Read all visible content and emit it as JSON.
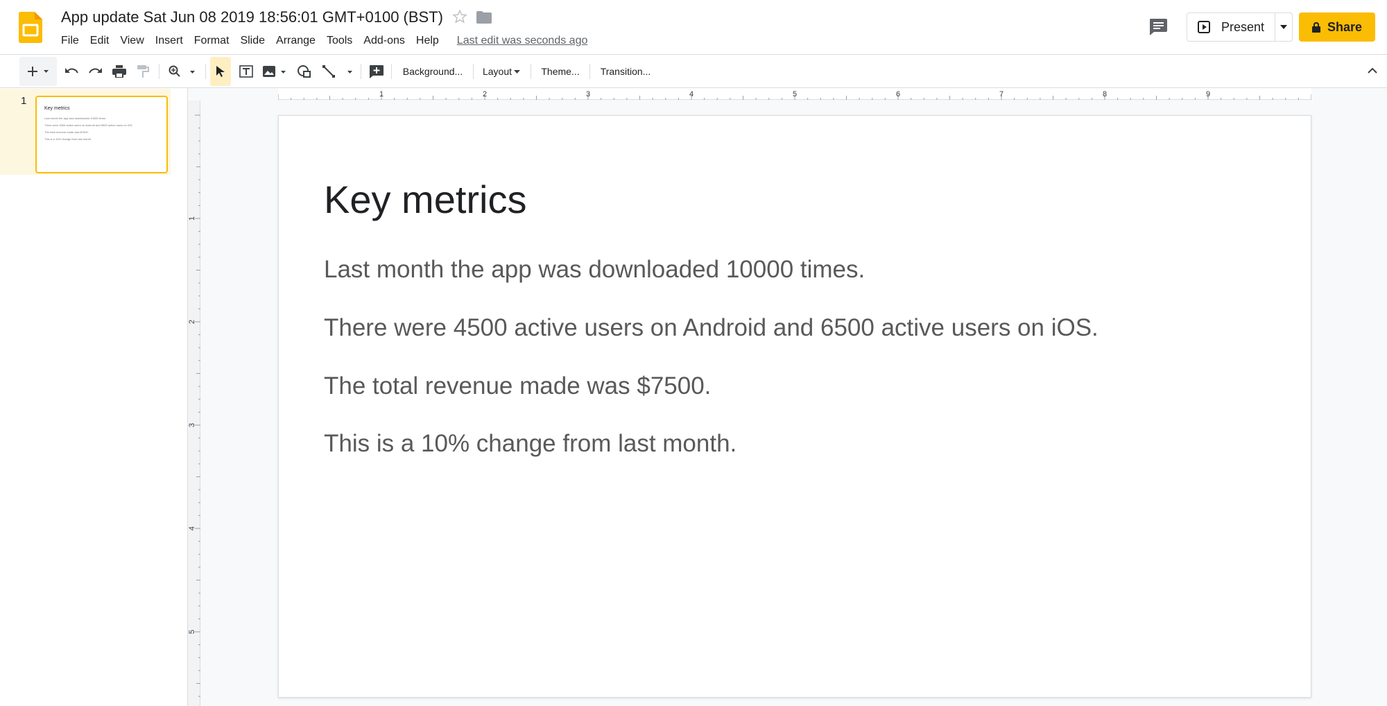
{
  "app": {
    "title": "App update Sat Jun 08 2019 18:56:01 GMT+0100 (BST)",
    "last_edit": "Last edit was seconds ago",
    "accent_color": "#fbbc04"
  },
  "menu": [
    "File",
    "Edit",
    "View",
    "Insert",
    "Format",
    "Slide",
    "Arrange",
    "Tools",
    "Add-ons",
    "Help"
  ],
  "header": {
    "present_label": "Present",
    "share_label": "Share"
  },
  "toolbar": {
    "background_label": "Background...",
    "layout_label": "Layout",
    "theme_label": "Theme...",
    "transition_label": "Transition...",
    "icons": [
      "new-slide-icon",
      "undo-icon",
      "redo-icon",
      "print-icon",
      "paint-format-icon",
      "zoom-icon",
      "select-icon",
      "text-box-icon",
      "image-icon",
      "shape-icon",
      "line-icon",
      "add-comment-icon"
    ]
  },
  "filmstrip": {
    "slides": [
      {
        "number": "1",
        "title": "Key metrics",
        "lines": [
          "Last month the app was downloaded 10000 times.",
          "There were 4500 active users on Android and 6500 active users on iOS.",
          "The total revenue made was $7500.",
          "This is a 10% change from last month."
        ]
      }
    ]
  },
  "ruler": {
    "horizontal_ticks": [
      "1",
      "2",
      "3",
      "4",
      "5",
      "6",
      "7",
      "8",
      "9"
    ],
    "vertical_ticks": [
      "1",
      "2",
      "3",
      "4",
      "5"
    ]
  },
  "slide": {
    "title": "Key metrics",
    "body": [
      "Last month the app was downloaded 10000 times.",
      "There were 4500 active users on Android and 6500 active users on iOS.",
      "The total revenue made was $7500.",
      "This is a 10% change from last month."
    ]
  }
}
